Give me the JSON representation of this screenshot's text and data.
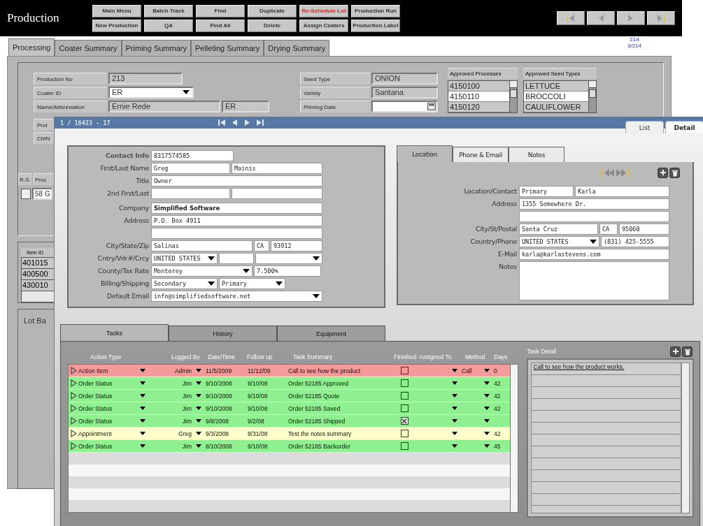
{
  "app": {
    "title": "Production",
    "toolbar": [
      {
        "label": "Main Menu",
        "warning": false
      },
      {
        "label": "Batch Track",
        "warning": false
      },
      {
        "label": "Find",
        "warning": false
      },
      {
        "label": "Duplicate",
        "warning": false
      },
      {
        "label": "Re-Schedule Lot",
        "warning": true
      },
      {
        "label": "Production Run",
        "warning": false
      },
      {
        "label": "New Production",
        "warning": false
      },
      {
        "label": "QA",
        "warning": false
      },
      {
        "label": "Find All",
        "warning": false
      },
      {
        "label": "Delete",
        "warning": false
      },
      {
        "label": "Assign Coaters",
        "warning": false
      },
      {
        "label": "Production Label",
        "warning": false
      }
    ],
    "record_counter": [
      "214",
      "3/214"
    ]
  },
  "tabs": [
    {
      "label": "Processing",
      "selected": true
    },
    {
      "label": "Coater Summary",
      "selected": false
    },
    {
      "label": "Priming Summary",
      "selected": false
    },
    {
      "label": "Pelleting Summary",
      "selected": false
    },
    {
      "label": "Drying Summary",
      "selected": false
    }
  ],
  "production_form": {
    "left": [
      {
        "label": "Production No",
        "kind": "readonly",
        "values": [
          "213"
        ]
      },
      {
        "label": "Coater ID",
        "kind": "dropdown",
        "values": [
          "ER"
        ]
      },
      {
        "label": "Name/Abbreviation",
        "kind": "readonly",
        "values": [
          "Ernie Rede",
          "ER"
        ]
      }
    ],
    "middle": [
      {
        "label": "Seed Type",
        "kind": "readonly",
        "values": [
          "ONION"
        ]
      },
      {
        "label": "Variety",
        "kind": "readonly",
        "values": [
          "Santana"
        ]
      },
      {
        "label": "Priming Date",
        "kind": "date"
      }
    ],
    "lists": [
      {
        "title": "Approved Processes",
        "items": [
          {
            "text": "4150100",
            "selected": false
          },
          {
            "text": "4150110",
            "selected": true
          },
          {
            "text": "4150120",
            "selected": false
          }
        ]
      },
      {
        "title": "Approved Seed Types",
        "items": [
          {
            "text": "LETTUCE",
            "selected": false
          },
          {
            "text": "BROCCOLI",
            "selected": true
          },
          {
            "text": "CAULIFLOWER",
            "selected": false
          }
        ]
      }
    ]
  },
  "obscured_form": {
    "labels": [
      "Prot",
      "CMN"
    ],
    "grid_headers": [
      "R-S",
      "Proc"
    ],
    "grid_row": {
      "checked": false,
      "value": "58 G"
    },
    "item_header": "Item ID",
    "items": [
      "401015",
      "400500",
      "430010"
    ],
    "panel_label": "Lot Ba"
  },
  "contact_window": {
    "record": "1 / 16433 - 17",
    "view_tabs": [
      {
        "label": "List",
        "selected": false
      },
      {
        "label": "Detail",
        "selected": true
      }
    ],
    "contact": [
      {
        "label": "Contact Info",
        "fields": [
          {
            "kind": "text",
            "value": "8317574585"
          }
        ]
      },
      {
        "label": "First/Last Name",
        "fields": [
          {
            "kind": "text",
            "value": "Greg"
          },
          {
            "kind": "text",
            "value": "Mainis"
          }
        ]
      },
      {
        "label": "Title",
        "fields": [
          {
            "kind": "text",
            "value": "Owner"
          }
        ]
      },
      {
        "label": "2nd First/Last",
        "fields": [
          {
            "kind": "text"
          },
          {
            "kind": "text"
          }
        ]
      },
      {
        "label": "Company",
        "fields": [
          {
            "kind": "text",
            "value": "Simplified Software",
            "bold": true
          }
        ]
      },
      {
        "label": "Address",
        "fields": [
          {
            "kind": "text",
            "value": "P.O. Box 4911"
          }
        ]
      },
      {
        "fields": [
          {
            "kind": "text"
          }
        ]
      },
      {
        "label": "City/State/Zip",
        "fields": [
          {
            "kind": "text",
            "value": "Salinas"
          },
          {
            "kind": "text",
            "value": "CA"
          },
          {
            "kind": "text",
            "value": "93912"
          }
        ]
      },
      {
        "label": "Cntry/Vdr#/Crcy",
        "fields": [
          {
            "kind": "dropdown",
            "value": "UNITED STATES"
          },
          {
            "kind": "text"
          },
          {
            "kind": "dropdown"
          }
        ]
      },
      {
        "label": "County/Tax Rate",
        "fields": [
          {
            "kind": "dropdown",
            "value": "Monterey"
          },
          {
            "kind": "text",
            "value": "7.500%"
          }
        ]
      },
      {
        "label": "Billing/Shipping",
        "fields": [
          {
            "kind": "dropdown",
            "value": "Secondary"
          },
          {
            "kind": "dropdown",
            "value": "Primary"
          }
        ]
      },
      {
        "label": "Default Email",
        "fields": [
          {
            "kind": "dropdown",
            "value": "info@simplifiedsoftware.net"
          }
        ]
      }
    ],
    "location_tabs": [
      {
        "label": "Location",
        "selected": true
      },
      {
        "label": "Phone & Email",
        "selected": false
      },
      {
        "label": "Notes",
        "selected": false
      }
    ],
    "location": [
      {
        "label": "Location/Contact",
        "fields": [
          {
            "kind": "text",
            "value": "Primary"
          },
          {
            "kind": "text",
            "value": "Karla"
          }
        ]
      },
      {
        "label": "Address",
        "fields": [
          {
            "kind": "text",
            "value": "1355 Somewhere Dr."
          }
        ]
      },
      {
        "fields": [
          {
            "kind": "text"
          }
        ]
      },
      {
        "label": "City/St/Postal",
        "fields": [
          {
            "kind": "text",
            "value": "Santa Cruz"
          },
          {
            "kind": "text",
            "value": "CA"
          },
          {
            "kind": "text",
            "value": "95060"
          }
        ]
      },
      {
        "label": "Country/Phone",
        "fields": [
          {
            "kind": "dropdown",
            "value": "UNITED STATES"
          },
          {
            "kind": "text",
            "value": "(831) 425-5555"
          }
        ]
      },
      {
        "label": "E-Mail",
        "fields": [
          {
            "kind": "text",
            "value": "karla@karlastevens.com"
          }
        ]
      },
      {
        "label": "Notes",
        "fields": [
          {
            "kind": "notes"
          }
        ]
      }
    ],
    "task_tabs": [
      {
        "label": "Tasks",
        "selected": true
      },
      {
        "label": "History",
        "selected": false
      },
      {
        "label": "Equipment",
        "selected": false
      }
    ],
    "task_columns": [
      "Action Type",
      "Logged By",
      "Date/Time",
      "Follow up",
      "Task Summary",
      "Finished",
      "Assigned To",
      "Method",
      "Days"
    ],
    "tasks": [
      {
        "action_type": "Action Item",
        "logged_by": "Admin",
        "date_time": "11/5/2009",
        "follow_up": "11/12/09",
        "summary": "Call to see how the product",
        "finished": false,
        "method": "Call",
        "days": "0",
        "color": "#f59a9a"
      },
      {
        "action_type": "Order Status",
        "logged_by": "Jim",
        "date_time": "9/10/2008",
        "follow_up": "9/10/08",
        "summary": "Order 52185 Approved",
        "finished": false,
        "days": "42",
        "color": "#8ef08e"
      },
      {
        "action_type": "Order Status",
        "logged_by": "Jim",
        "date_time": "9/10/2008",
        "follow_up": "9/10/08",
        "summary": "Order 52185 Quote",
        "finished": false,
        "days": "42",
        "color": "#8ef08e"
      },
      {
        "action_type": "Order Status",
        "logged_by": "Jim",
        "date_time": "9/10/2008",
        "follow_up": "9/10/08",
        "summary": "Order 52185 Saved",
        "finished": false,
        "days": "42",
        "color": "#8ef08e"
      },
      {
        "action_type": "Order Status",
        "logged_by": "Jim",
        "date_time": "9/8/2008",
        "follow_up": "9/2/08",
        "summary": "Order 52185 Shipped",
        "finished": true,
        "color": "#8ef08e"
      },
      {
        "action_type": "Appointment",
        "logged_by": "Greg",
        "date_time": "9/3/2008",
        "follow_up": "8/31/08",
        "summary": "Test the notes summary",
        "finished": false,
        "days": "42",
        "color": "#ffffcc"
      },
      {
        "action_type": "Order Status",
        "logged_by": "Jim",
        "date_time": "8/10/2008",
        "follow_up": "9/10/08",
        "summary": "Order 52185 Backorder",
        "finished": false,
        "days": "45",
        "color": "#8ef08e"
      }
    ],
    "task_detail": {
      "title": "Task Detail",
      "text": "Call to see how the product works."
    }
  }
}
